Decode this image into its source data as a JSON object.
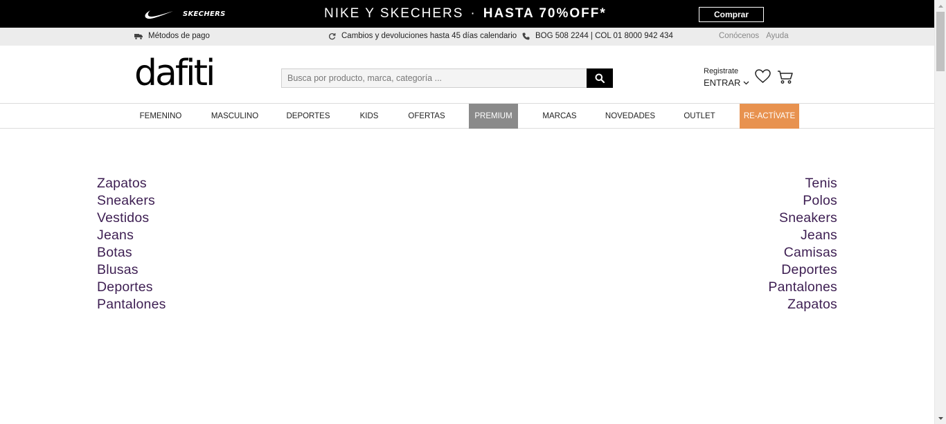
{
  "promo": {
    "brand_a": "NIKE",
    "brand_b": "SKECHERS",
    "headline_a": "NIKE Y SKECHERS",
    "separator": "·",
    "headline_b": "HASTA 70%OFF*",
    "cta_label": "Comprar"
  },
  "info_bar": {
    "payment": "Métodos de pago",
    "returns": "Cambios y devoluciones hasta 45 días calendario",
    "phones": "BOG 508 2244 | COL 01 8000 942 434",
    "about": "Conócenos",
    "help": "Ayuda"
  },
  "header": {
    "logo": "dafiti",
    "search_placeholder": "Busca por producto, marca, categoría ...",
    "register": "Registrate",
    "login": "ENTRAR"
  },
  "nav": {
    "items": [
      "FEMENINO",
      "MASCULINO",
      "DEPORTES",
      "KIDS",
      "OFERTAS",
      "PREMIUM",
      "MARCAS",
      "NOVEDADES",
      "OUTLET",
      "RE-ACTÍVATE"
    ]
  },
  "lists": {
    "left": [
      "Zapatos",
      "Sneakers",
      "Vestidos",
      "Jeans",
      "Botas",
      "Blusas",
      "Deportes",
      "Pantalones"
    ],
    "right": [
      "Tenis",
      "Polos",
      "Sneakers",
      "Jeans",
      "Camisas",
      "Deportes",
      "Pantalones",
      "Zapatos"
    ]
  },
  "colors": {
    "premium_bg": "#8a8a8a",
    "reactivate_bg": "#e8924f",
    "link_color": "#3d1e52"
  }
}
